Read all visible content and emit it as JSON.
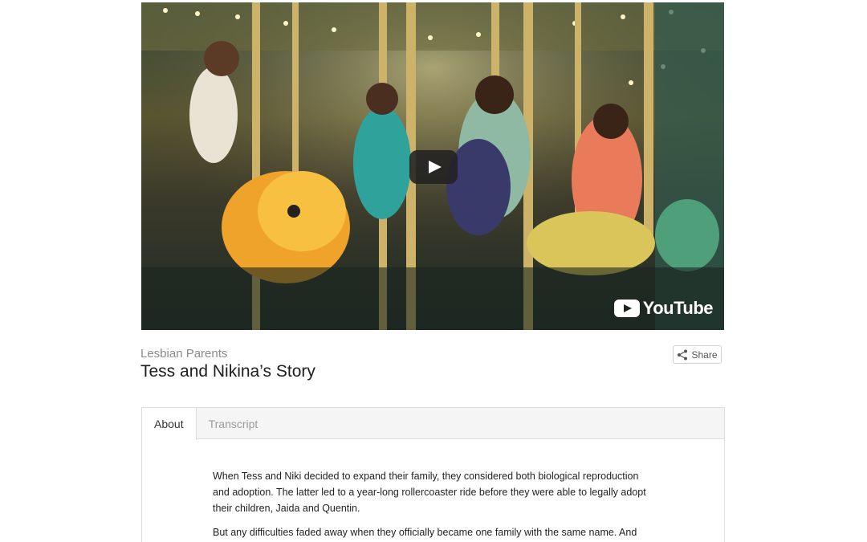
{
  "video": {
    "play_icon": "play-icon",
    "provider_icon": "youtube-icon",
    "provider_label": "YouTube"
  },
  "story": {
    "category": "Lesbian Parents",
    "title": "Tess and Nikina’s Story"
  },
  "share": {
    "label": "Share",
    "icon": "share-icon"
  },
  "tabs": [
    {
      "label": "About",
      "active": true
    },
    {
      "label": "Transcript",
      "active": false
    }
  ],
  "about": {
    "paragraphs": [
      "When Tess and Niki decided to expand their family, they considered both biological reproduction and adoption. The latter led to a year-long rollercoaster ride before they were able to legally adopt their children, Jaida and Quentin.",
      "But any difficulties faded away when they officially became one family with the same name. And"
    ]
  }
}
